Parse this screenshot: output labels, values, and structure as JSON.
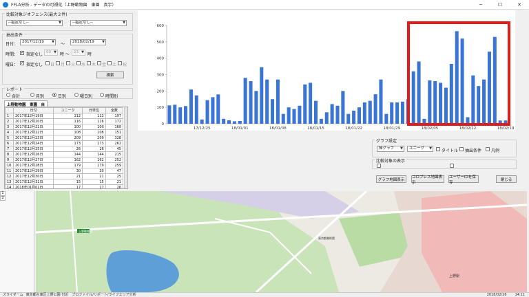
{
  "window": {
    "title": "FFLA分析 - データの可視化（上野動物園　東園　真宇）",
    "controls": [
      "─",
      "☐",
      "✕"
    ]
  },
  "compare": {
    "legend": "比較対象ジオフェンス(最大２件)",
    "select1": "--指定なし--",
    "select2": "--指定なし--"
  },
  "filter": {
    "legend": "抽出条件",
    "date_label": "日付：",
    "date_from": "2017/12/19",
    "tilde": "～",
    "date_to": "2018/02/19",
    "time_label": "時間：",
    "time_check_label": "指定なし",
    "hour_from": "00",
    "hour_sep": "時 ～",
    "hour_to": "23",
    "hour_suffix": "時",
    "weekday_label": "曜日：",
    "weekday_check_label": "指定なし",
    "weekdays": [
      "日",
      "月",
      "火",
      "水",
      "木",
      "金",
      "土",
      "祝"
    ],
    "search_button": "検索"
  },
  "report": {
    "legend": "レポート",
    "options": [
      "合計",
      "月別",
      "日別",
      "曜日別",
      "時間別"
    ],
    "selected": "日別"
  },
  "table": {
    "tab": "上野動物園　東園　自",
    "headers": [
      "",
      "日付",
      "ユニーク",
      "日単位",
      "全数"
    ],
    "rows": [
      [
        "1",
        "2017年12月19日",
        "112",
        "112",
        "197"
      ],
      [
        "2",
        "2017年12月20日",
        "116",
        "116",
        "172"
      ],
      [
        "3",
        "2017年12月21日",
        "100",
        "100",
        "168"
      ],
      [
        "4",
        "2017年12月22日",
        "108",
        "108",
        "151"
      ],
      [
        "5",
        "2017年12月23日",
        "209",
        "209",
        "328"
      ],
      [
        "6",
        "2017年12月24日",
        "173",
        "173",
        "262"
      ],
      [
        "7",
        "2017年12月25日",
        "26",
        "26",
        "45"
      ],
      [
        "8",
        "2017年12月26日",
        "144",
        "144",
        "215"
      ],
      [
        "9",
        "2017年12月27日",
        "162",
        "162",
        "252"
      ],
      [
        "10",
        "2017年12月28日",
        "179",
        "179",
        "259"
      ],
      [
        "11",
        "2017年12月29日",
        "30",
        "30",
        "47"
      ],
      [
        "12",
        "2017年12月30日",
        "21",
        "21",
        "25"
      ],
      [
        "13",
        "2017年12月31日",
        "15",
        "15",
        "21"
      ],
      [
        "14",
        "2018年01月01日",
        "17",
        "17",
        "26"
      ]
    ]
  },
  "chart_data": {
    "type": "bar",
    "color": "#3a74d4",
    "ylim": [
      0,
      600
    ],
    "yticks": [
      0,
      100,
      200,
      300,
      400,
      500,
      600
    ],
    "xticklabels": [
      "17/12/25",
      "18/01/01",
      "18/01/08",
      "18/01/15",
      "18/01/22",
      "18/01/29",
      "18/02/05",
      "18/02/12",
      "18/02/19"
    ],
    "categories": [
      "17/12/19",
      "17/12/20",
      "17/12/21",
      "17/12/22",
      "17/12/23",
      "17/12/24",
      "17/12/25",
      "17/12/26",
      "17/12/27",
      "17/12/28",
      "17/12/29",
      "17/12/30",
      "17/12/31",
      "18/01/01",
      "18/01/02",
      "18/01/03",
      "18/01/04",
      "18/01/05",
      "18/01/06",
      "18/01/07",
      "18/01/08",
      "18/01/09",
      "18/01/10",
      "18/01/11",
      "18/01/12",
      "18/01/13",
      "18/01/14",
      "18/01/15",
      "18/01/16",
      "18/01/17",
      "18/01/18",
      "18/01/19",
      "18/01/20",
      "18/01/21",
      "18/01/22",
      "18/01/23",
      "18/01/24",
      "18/01/25",
      "18/01/26",
      "18/01/27",
      "18/01/28",
      "18/01/29",
      "18/01/30",
      "18/01/31",
      "18/02/01",
      "18/02/02",
      "18/02/03",
      "18/02/04",
      "18/02/05",
      "18/02/06",
      "18/02/07",
      "18/02/08",
      "18/02/09",
      "18/02/10",
      "18/02/11",
      "18/02/12",
      "18/02/13",
      "18/02/14",
      "18/02/15",
      "18/02/16",
      "18/02/17",
      "18/02/18",
      "18/02/19"
    ],
    "values": [
      112,
      116,
      100,
      108,
      209,
      173,
      26,
      144,
      162,
      179,
      30,
      21,
      15,
      17,
      280,
      260,
      200,
      345,
      270,
      150,
      270,
      60,
      100,
      90,
      110,
      240,
      250,
      140,
      30,
      70,
      120,
      110,
      200,
      60,
      80,
      100,
      130,
      140,
      180,
      270,
      60,
      130,
      130,
      135,
      150,
      320,
      380,
      30,
      265,
      260,
      250,
      220,
      365,
      565,
      520,
      40,
      295,
      230,
      270,
      440,
      530,
      20,
      20
    ]
  },
  "graph_settings": {
    "legend": "グラフ設定",
    "graph_type": "棒グラフ",
    "metric": "ユニーク",
    "checks": [
      "タイトル",
      "抽出条件",
      "凡例"
    ]
  },
  "compare_display": {
    "legend": "比較対象の表示"
  },
  "actions": {
    "graph_map": "グラフ地図表示",
    "choropleth_map": "コロプレス地図表示",
    "user_save": "ユーザーIDを保存",
    "close": "閉じる"
  },
  "map": {
    "labels": [
      "上野動物園",
      "東京都美術館",
      "上野駅"
    ]
  },
  "lower_left": {
    "rows": [
      "1",
      "2"
    ]
  },
  "status": {
    "left": "ズライダーム",
    "middle": "東京都台東区上野公園 付近　プロファイル/リポート/ライフエリア分析",
    "date": "2018/02/26",
    "time": "14:11"
  }
}
